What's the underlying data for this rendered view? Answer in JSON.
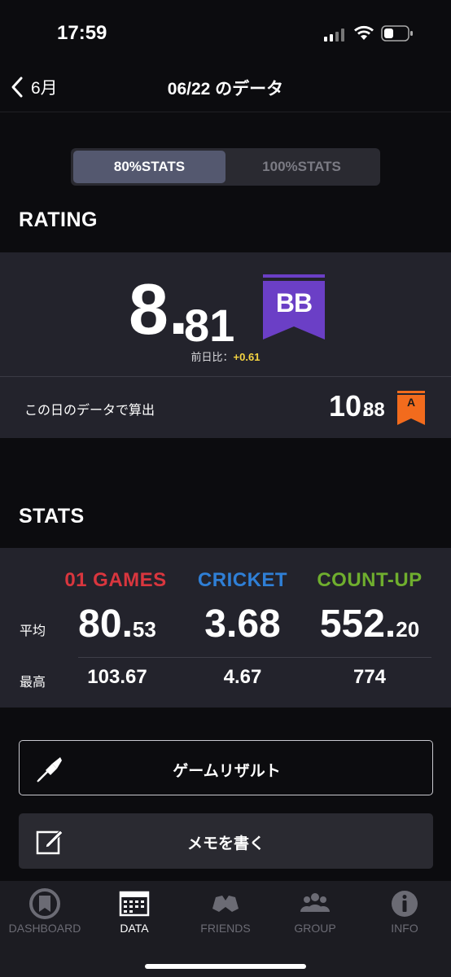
{
  "status": {
    "time": "17:59"
  },
  "nav": {
    "back_label": "6月",
    "title": "06/22 のデータ"
  },
  "segment": {
    "options": [
      "80%STATS",
      "100%STATS"
    ],
    "selected": "80%STATS"
  },
  "rating": {
    "section_title": "RATING",
    "value_int": "8.",
    "value_dec": "81",
    "class_badge": "BB",
    "diff_label": "前日比：",
    "diff_value": "+0.61",
    "calc_label": "この日のデータで算出",
    "calc_value_int": "10.",
    "calc_value_dec": "88",
    "calc_badge": "A"
  },
  "stats": {
    "section_title": "STATS",
    "avg_label": "平均",
    "max_label": "最高",
    "columns": [
      {
        "name": "01 GAMES",
        "color": "#d9363e",
        "avg_int": "80.",
        "avg_dec": "53",
        "max": "103.67"
      },
      {
        "name": "CRICKET",
        "color": "#2f7fd6",
        "avg_int": "3.68",
        "avg_dec": "",
        "max": "4.67"
      },
      {
        "name": "COUNT-UP",
        "color": "#6fae2e",
        "avg_int": "552.",
        "avg_dec": "20",
        "max": "774"
      }
    ]
  },
  "actions": {
    "game_result": "ゲームリザルト",
    "write_memo": "メモを書く"
  },
  "tabs": [
    {
      "label": "DASHBOARD",
      "icon": "dashboard-icon"
    },
    {
      "label": "DATA",
      "icon": "calendar-icon"
    },
    {
      "label": "FRIENDS",
      "icon": "friends-icon"
    },
    {
      "label": "GROUP",
      "icon": "group-icon"
    },
    {
      "label": "INFO",
      "icon": "info-icon"
    }
  ],
  "colors": {
    "accent_purple": "#6b3fc6",
    "badge_orange": "#f26b1d",
    "diff_yellow": "#f5d442"
  }
}
